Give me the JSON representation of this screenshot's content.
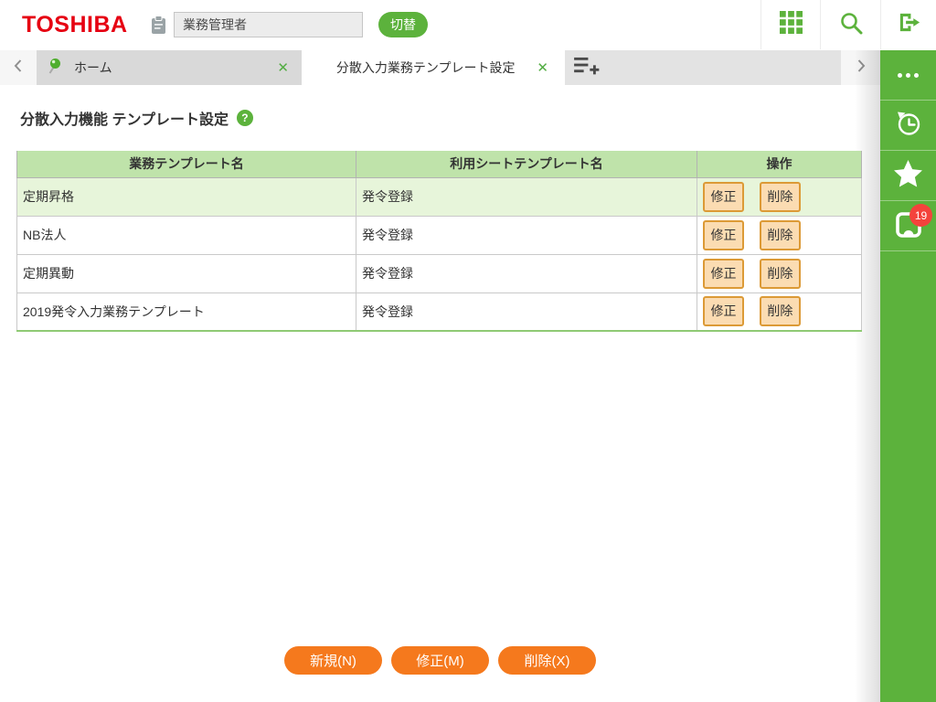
{
  "header": {
    "logo": "TOSHIBA",
    "user_input": {
      "value": "業務管理者"
    },
    "switch_label": "切替"
  },
  "tabbar": {
    "tabs": [
      {
        "label": "ホーム",
        "pinned": true,
        "active": false
      },
      {
        "label": "分散入力業務テンプレート設定",
        "active": true
      }
    ],
    "close_glyph": "✕"
  },
  "sidebar": {
    "notification_count": "19"
  },
  "page": {
    "title": "分散入力機能 テンプレート設定",
    "help_glyph": "?"
  },
  "table": {
    "headers": [
      "業務テンプレート名",
      "利用シートテンプレート名",
      "操作"
    ],
    "rows": [
      {
        "template": "定期昇格",
        "sheet": "発令登録",
        "highlighted": true
      },
      {
        "template": "NB法人",
        "sheet": "発令登録",
        "highlighted": false
      },
      {
        "template": "定期異動",
        "sheet": "発令登録",
        "highlighted": false
      },
      {
        "template": "2019発令入力業務テンプレート",
        "sheet": "発令登録",
        "highlighted": false
      }
    ],
    "row_actions": {
      "edit": "修正",
      "delete": "削除"
    }
  },
  "footer": {
    "buttons": [
      {
        "id": "new",
        "label": "新規(N)"
      },
      {
        "id": "edit",
        "label": "修正(M)"
      },
      {
        "id": "delete",
        "label": "削除(X)"
      }
    ]
  },
  "icons": {
    "clipboard": "clipboard",
    "app_grid": "grid-3x3",
    "search": "magnifier",
    "logout": "door-arrow-right",
    "pin": "green-pin",
    "add_tab": "list-plus",
    "back": "chevron-left",
    "forward": "chevron-right",
    "menu": "three-dots",
    "history": "clock-counterclockwise",
    "favorites": "star",
    "notifications": "tray-badge",
    "help": "question-circle"
  },
  "colors": {
    "accent_green": "#5cb23c",
    "logo_red": "#e60012",
    "table_header_green": "#bfe3aa",
    "row_highlight_green": "#e7f5da",
    "action_button_peach": "#fbdcb2",
    "action_button_border": "#dc9a36",
    "footer_orange": "#f5791d",
    "badge_red": "#f4433c"
  }
}
